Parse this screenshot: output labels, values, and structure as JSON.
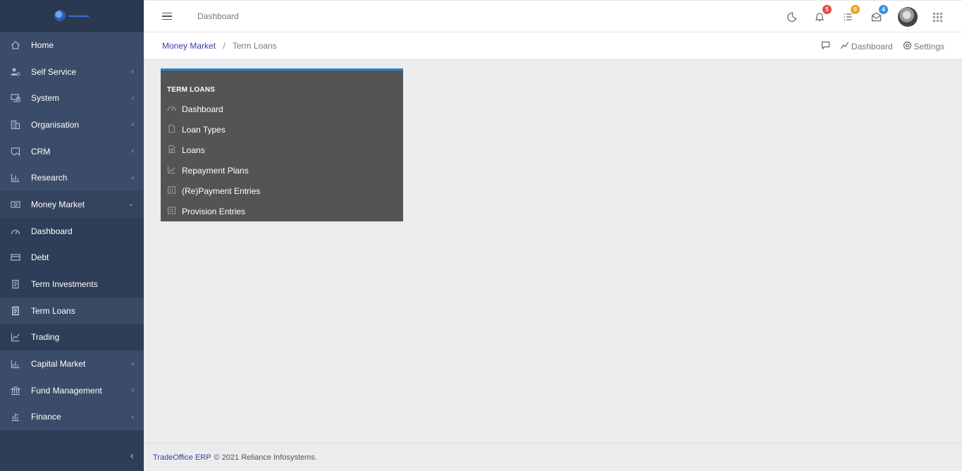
{
  "app": {
    "logo_alt": "logo",
    "header_title": "Dashboard"
  },
  "sidebar": {
    "items": [
      {
        "label": "Home",
        "icon": "home-icon",
        "arrow": ""
      },
      {
        "label": "Self Service",
        "icon": "user-gear-icon",
        "arrow": "‹"
      },
      {
        "label": "System",
        "icon": "devices-icon",
        "arrow": "‹"
      },
      {
        "label": "Organisation",
        "icon": "building-icon",
        "arrow": "‹"
      },
      {
        "label": "CRM",
        "icon": "map-icon",
        "arrow": "‹"
      },
      {
        "label": "Research",
        "icon": "bar-chart-icon",
        "arrow": "‹"
      },
      {
        "label": "Money Market",
        "icon": "money-icon",
        "arrow": "⌄"
      },
      {
        "label": "Dashboard",
        "icon": "gauge-icon",
        "arrow": ""
      },
      {
        "label": "Debt",
        "icon": "credit-card-icon",
        "arrow": ""
      },
      {
        "label": "Term Investments",
        "icon": "receipt-icon",
        "arrow": ""
      },
      {
        "label": "Term Loans",
        "icon": "receipt-icon",
        "arrow": ""
      },
      {
        "label": "Trading",
        "icon": "line-chart-icon",
        "arrow": ""
      },
      {
        "label": "Capital Market",
        "icon": "bar-chart-icon",
        "arrow": "‹"
      },
      {
        "label": "Fund Management",
        "icon": "bank-icon",
        "arrow": "‹"
      },
      {
        "label": "Finance",
        "icon": "finance-chart-icon",
        "arrow": "‹"
      }
    ],
    "collapse_icon": "‹"
  },
  "header": {
    "notifications_count": "5",
    "tasks_count": "0",
    "messages_count": "4"
  },
  "breadcrumb": {
    "parent": "Money Market",
    "separator": "/",
    "current": "Term Loans",
    "actions": {
      "dashboard": "Dashboard",
      "settings": "Settings"
    }
  },
  "panel": {
    "title": "TERM LOANS",
    "items": [
      {
        "label": "Dashboard",
        "icon": "gauge-icon"
      },
      {
        "label": "Loan Types",
        "icon": "file-icon"
      },
      {
        "label": "Loans",
        "icon": "document-icon"
      },
      {
        "label": "Repayment Plans",
        "icon": "line-chart-icon"
      },
      {
        "label": "(Re)Payment Entries",
        "icon": "ledger-icon"
      },
      {
        "label": "Provision Entries",
        "icon": "ledger-icon"
      }
    ]
  },
  "footer": {
    "brand": "TradeOffice ERP",
    "copyright": "© 2021 Reliance Infosystems."
  },
  "colors": {
    "sidebar_bg": "#2e3e58",
    "accent_blue": "#2a86d1",
    "panel_bg": "#525455",
    "link": "#3b3f9e"
  }
}
